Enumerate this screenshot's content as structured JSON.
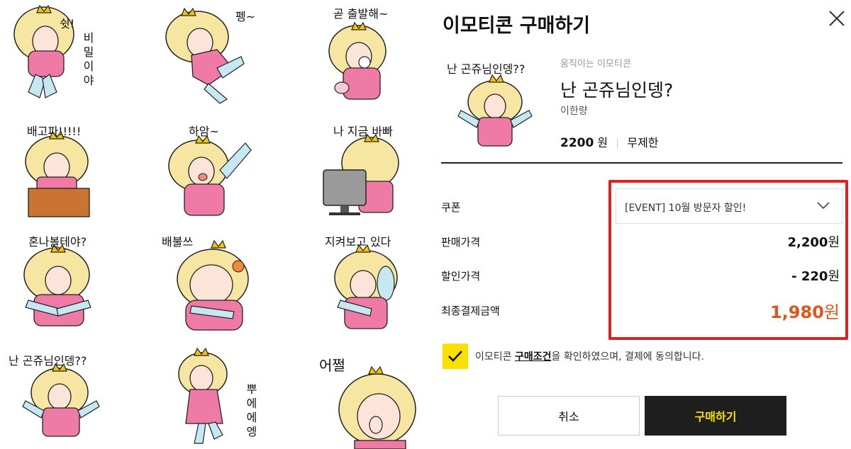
{
  "stickers": [
    {
      "caption": "쉿!",
      "vertical": "비밀이야"
    },
    {
      "caption": "펭~"
    },
    {
      "caption": "곧 출발해~"
    },
    {
      "caption": "배고파!!!!!"
    },
    {
      "caption": "하암~"
    },
    {
      "caption": "나 지금 바빠"
    },
    {
      "caption": "혼나볼테야?"
    },
    {
      "caption": "배불쓰"
    },
    {
      "caption": "지켜보고 있다"
    },
    {
      "caption": "난 곤쥬님인뎅??"
    },
    {
      "caption": "",
      "vertical": "뿌에에엥"
    },
    {
      "caption": "어쩔"
    }
  ],
  "panel": {
    "title": "이모티콘 구매하기",
    "thumb_caption": "난 곤쥬님인뎅??",
    "kind": "움직이는 이모티콘",
    "name": "난 곤쥬님인뎅?",
    "author": "이한량",
    "price_value": "2200",
    "price_unit": "원",
    "period": "무제한",
    "coupon_label": "쿠폰",
    "coupon_selected": "[EVENT] 10월 방문자 할인!",
    "sale_label": "판매가격",
    "sale_value": "2,200",
    "discount_label": "할인가격",
    "discount_value": "- 220",
    "final_label": "최종결제금액",
    "final_value": "1,980",
    "currency": "원",
    "agree_prefix": "이모티콘 ",
    "agree_link": "구매조건",
    "agree_suffix": "을 확인하였으며, 결제에 동의합니다.",
    "cancel_label": "취소",
    "buy_label": "구매하기"
  },
  "colors": {
    "accent_yellow": "#fae100",
    "final_price": "#e2551b",
    "highlight_red": "#e02020",
    "dress_pink": "#f07aa6"
  },
  "icons": [
    "close-icon",
    "chevron-down-icon",
    "check-icon"
  ]
}
